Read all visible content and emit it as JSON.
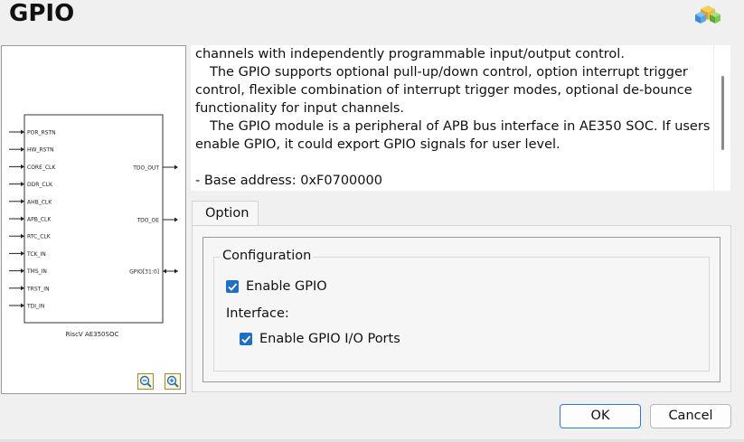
{
  "dialog": {
    "title": "GPIO"
  },
  "diagram": {
    "block_label": "RiscV AE350SOC",
    "inputs": [
      "POR_RSTN",
      "HW_RSTN",
      "CORE_CLK",
      "DDR_CLK",
      "AHB_CLK",
      "APB_CLK",
      "RTC_CLK",
      "TCK_IN",
      "TMS_IN",
      "TRST_IN",
      "TDI_IN"
    ],
    "outputs": [
      "TDO_OUT",
      "TDO_OE"
    ],
    "bidirectional": [
      "GPIO[31:0]"
    ],
    "zoom_out_icon": "zoom-out-icon",
    "zoom_in_icon": "zoom-in-icon"
  },
  "description": {
    "lines": [
      "channels with independently programmable input/output control.",
      "The GPIO supports optional pull-up/down control, option interrupt trigger control, flexible combination of interrupt trigger modes, optional de-bounce functionality for input channels.",
      "The GPIO module is a peripheral of APB bus interface in AE350 SOC. If users enable GPIO, it could export GPIO signals for user level.",
      "",
      "- Base address: 0xF0700000"
    ]
  },
  "tabs": [
    {
      "label": "Option"
    }
  ],
  "configuration": {
    "title": "Configuration",
    "enable_gpio": {
      "label": "Enable GPIO",
      "checked": true
    },
    "interface_label": "Interface:",
    "enable_ports": {
      "label": "Enable GPIO I/O Ports",
      "checked": true
    }
  },
  "buttons": {
    "ok": "OK",
    "cancel": "Cancel"
  },
  "colors": {
    "accent": "#1f6fc4",
    "primary_border": "#2f7bd3"
  }
}
